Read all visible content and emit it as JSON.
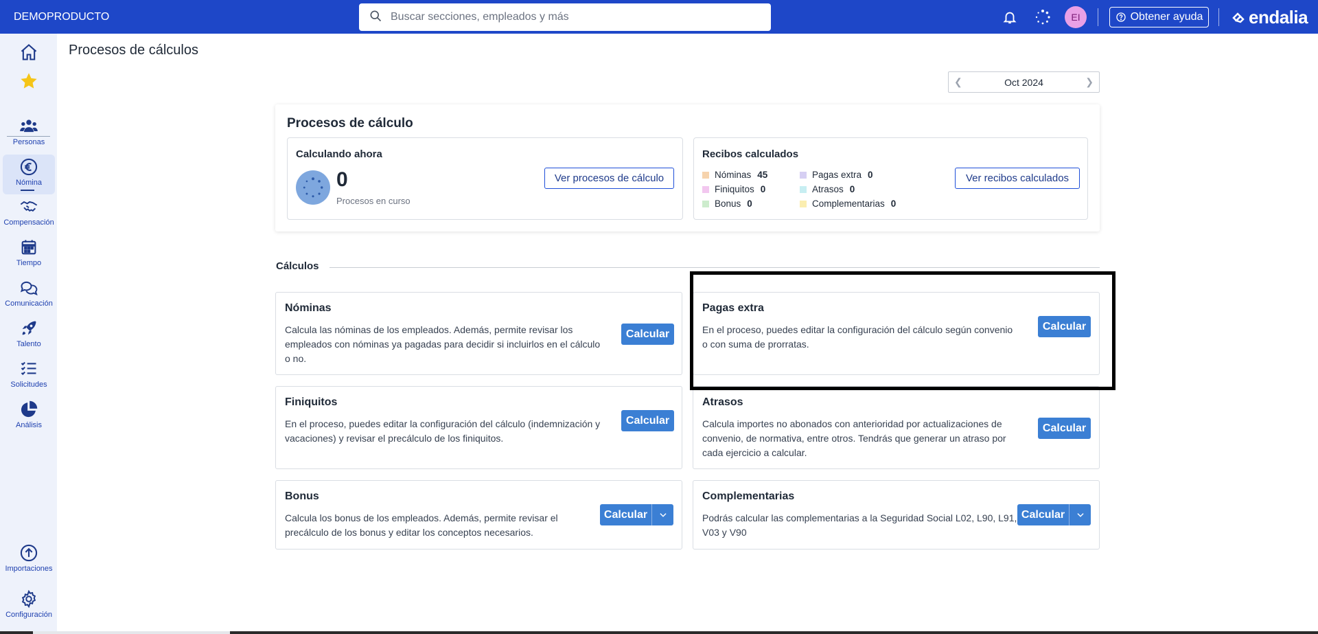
{
  "topbar": {
    "brand": "DEMOPRODUCTO",
    "search_placeholder": "Buscar secciones, empleados y más",
    "avatar_initials": "EI",
    "help_label": "Obtener ayuda",
    "logo_text": "endalia"
  },
  "sidebar": {
    "items": [
      {
        "label": "",
        "icon": "home-icon"
      },
      {
        "label": "",
        "icon": "star-icon"
      },
      {
        "label": "Personas",
        "icon": "people-icon"
      },
      {
        "label": "Nómina",
        "icon": "euro-icon"
      },
      {
        "label": "Compensación",
        "icon": "handshake-icon"
      },
      {
        "label": "Tiempo",
        "icon": "calendar-icon"
      },
      {
        "label": "Comunicación",
        "icon": "chat-icon"
      },
      {
        "label": "Talento",
        "icon": "rocket-icon"
      },
      {
        "label": "Solicitudes",
        "icon": "checklist-icon"
      },
      {
        "label": "Análisis",
        "icon": "pie-chart-icon"
      },
      {
        "label": "Importaciones",
        "icon": "upload-icon"
      },
      {
        "label": "Configuración",
        "icon": "gear-icon"
      }
    ]
  },
  "page": {
    "title": "Procesos de cálculos",
    "month": "Oct 2024"
  },
  "summary": {
    "title": "Procesos de cálculo",
    "running": {
      "title": "Calculando ahora",
      "count": "0",
      "caption": "Procesos en curso",
      "button": "Ver procesos de cálculo"
    },
    "receipts": {
      "title": "Recibos calculados",
      "button": "Ver recibos calculados",
      "items": [
        {
          "label": "Nóminas",
          "count": "45",
          "color": "#f6d3ad"
        },
        {
          "label": "Finiquitos",
          "count": "0",
          "color": "#f2c7ef"
        },
        {
          "label": "Bonus",
          "count": "0",
          "color": "#cdeccd"
        },
        {
          "label": "Pagas extra",
          "count": "0",
          "color": "#d6cff3"
        },
        {
          "label": "Atrasos",
          "count": "0",
          "color": "#c7eef2"
        },
        {
          "label": "Complementarias",
          "count": "0",
          "color": "#fbeeb0"
        }
      ]
    }
  },
  "calculos": {
    "section_title": "Cálculos",
    "cards": [
      {
        "title": "Nóminas",
        "desc": "Calcula las nóminas de los empleados. Además, permite revisar los empleados con nóminas ya pagadas para decidir si incluirlos en el cálculo o no.",
        "button": "Calcular"
      },
      {
        "title": "Pagas extra",
        "desc": "En el proceso, puedes editar la configuración del cálculo según convenio o con suma de prorratas.",
        "button": "Calcular"
      },
      {
        "title": "Finiquitos",
        "desc": "En el proceso, puedes editar la configuración del cálculo (indemnización y vacaciones) y revisar el precálculo de los finiquitos.",
        "button": "Calcular"
      },
      {
        "title": "Atrasos",
        "desc": "Calcula importes no abonados con anterioridad por actualizaciones de convenio, de normativa, entre otros. Tendrás que generar un atraso por cada ejercicio a calcular.",
        "button": "Calcular"
      },
      {
        "title": "Bonus",
        "desc": "Calcula los bonus de los empleados. Además, permite revisar el precálculo de los bonus y editar los conceptos necesarios.",
        "button": "Calcular"
      },
      {
        "title": "Complementarias",
        "desc": "Podrás calcular las complementarias a la Seguridad Social L02, L90, L91, V03 y V90",
        "button": "Calcular"
      }
    ]
  }
}
